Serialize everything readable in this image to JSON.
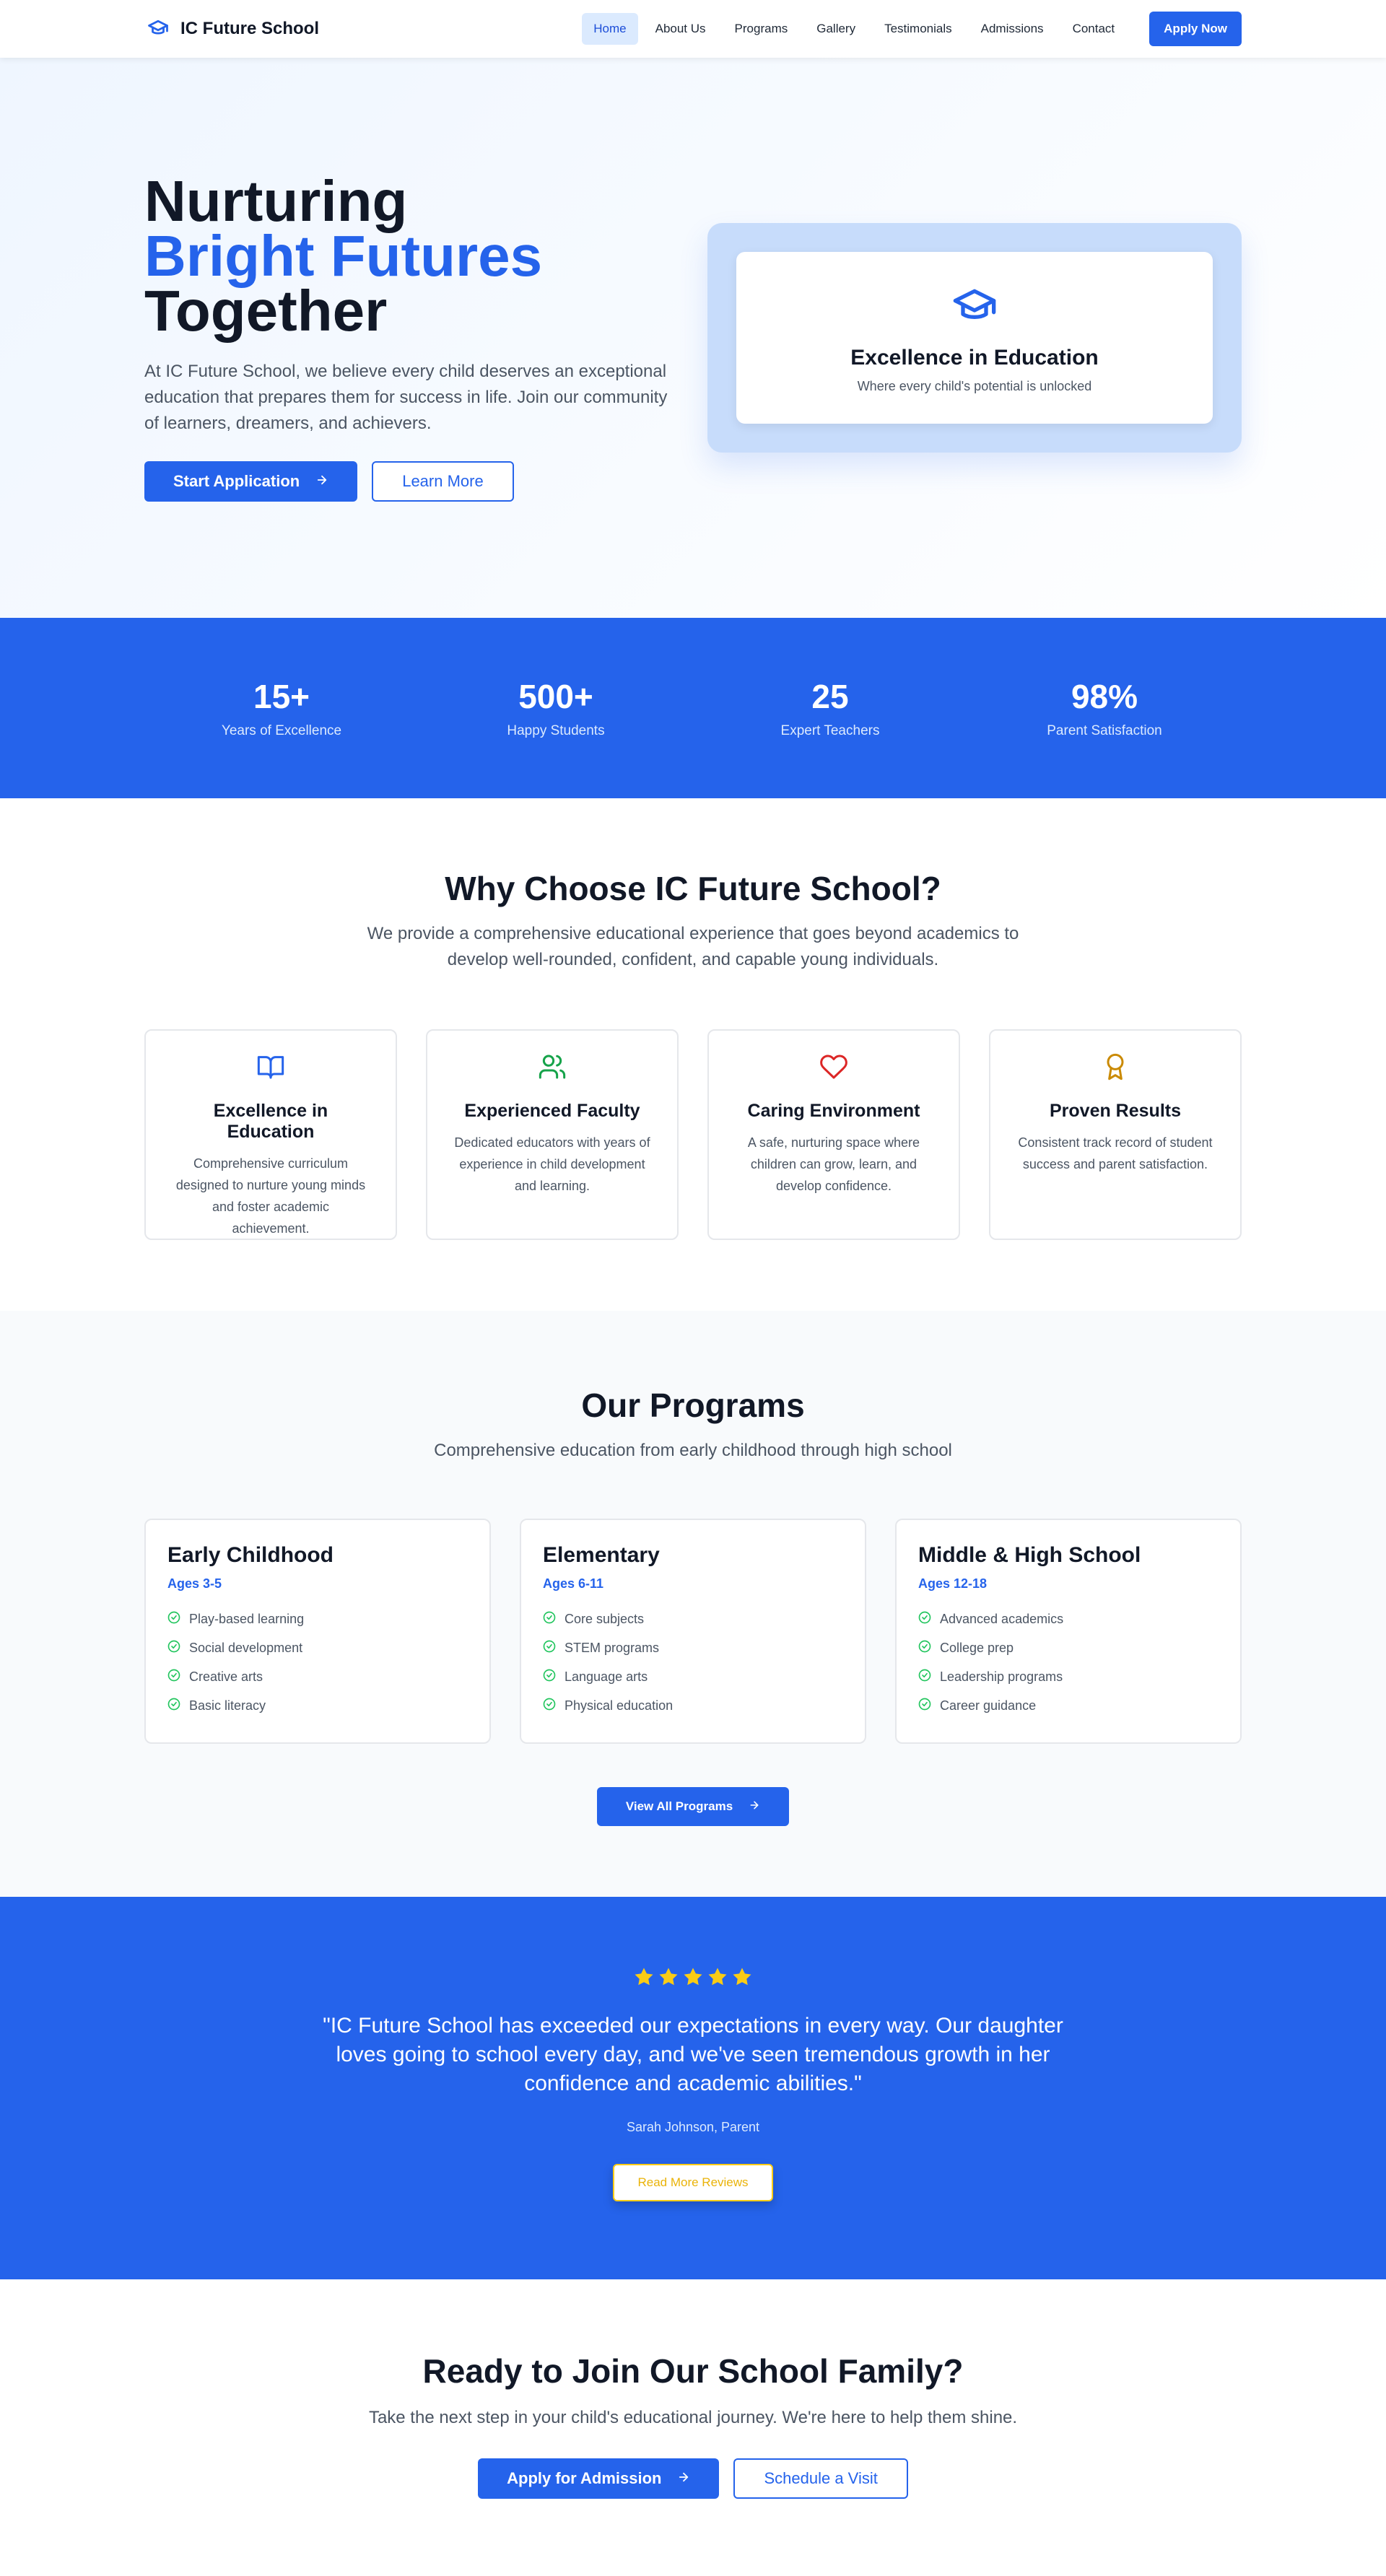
{
  "nav": {
    "brand": "IC Future School",
    "links": [
      "Home",
      "About Us",
      "Programs",
      "Gallery",
      "Testimonials",
      "Admissions",
      "Contact"
    ],
    "cta": "Apply Now"
  },
  "hero": {
    "title_line1": "Nurturing",
    "title_line2": "Bright Futures",
    "title_line3": "Together",
    "description": "At IC Future School, we believe every child deserves an exceptional education that prepares them for success in life. Join our community of learners, dreamers, and achievers.",
    "primary_btn": "Start Application",
    "secondary_btn": "Learn More",
    "card_title": "Excellence in Education",
    "card_subtitle": "Where every child's potential is unlocked"
  },
  "stats": [
    {
      "number": "15+",
      "label": "Years of Excellence"
    },
    {
      "number": "500+",
      "label": "Happy Students"
    },
    {
      "number": "25",
      "label": "Expert Teachers"
    },
    {
      "number": "98%",
      "label": "Parent Satisfaction"
    }
  ],
  "why": {
    "title": "Why Choose IC Future School?",
    "subtitle": "We provide a comprehensive educational experience that goes beyond academics to develop well-rounded, confident, and capable young individuals.",
    "features": [
      {
        "icon": "book-open-icon",
        "title": "Excellence in Education",
        "desc": "Comprehensive curriculum designed to nurture young minds and foster academic achievement."
      },
      {
        "icon": "users-icon",
        "title": "Experienced Faculty",
        "desc": "Dedicated educators with years of experience in child development and learning."
      },
      {
        "icon": "heart-icon",
        "title": "Caring Environment",
        "desc": "A safe, nurturing space where children can grow, learn, and develop confidence."
      },
      {
        "icon": "award-icon",
        "title": "Proven Results",
        "desc": "Consistent track record of student success and parent satisfaction."
      }
    ]
  },
  "programs": {
    "title": "Our Programs",
    "subtitle": "Comprehensive education from early childhood through high school",
    "items": [
      {
        "title": "Early Childhood",
        "ages": "Ages 3-5",
        "features": [
          "Play-based learning",
          "Social development",
          "Creative arts",
          "Basic literacy"
        ]
      },
      {
        "title": "Elementary",
        "ages": "Ages 6-11",
        "features": [
          "Core subjects",
          "STEM programs",
          "Language arts",
          "Physical education"
        ]
      },
      {
        "title": "Middle & High School",
        "ages": "Ages 12-18",
        "features": [
          "Advanced academics",
          "College prep",
          "Leadership programs",
          "Career guidance"
        ]
      }
    ],
    "button": "View All Programs"
  },
  "testimonial": {
    "rating": 5,
    "quote": "\"IC Future School has exceeded our expectations in every way. Our daughter loves going to school every day, and we've seen tremendous growth in her confidence and academic abilities.\"",
    "author": "Sarah Johnson, Parent",
    "button": "Read More Reviews"
  },
  "cta": {
    "title": "Ready to Join Our School Family?",
    "subtitle": "Take the next step in your child's educational journey. We're here to help them shine.",
    "primary_btn": "Apply for Admission",
    "secondary_btn": "Schedule a Visit"
  },
  "colors": {
    "primary": "#2563eb",
    "green_check": "#22c55e",
    "heart_red": "#dc2626",
    "award_gold": "#ca8a04",
    "star_yellow": "#facc15"
  }
}
